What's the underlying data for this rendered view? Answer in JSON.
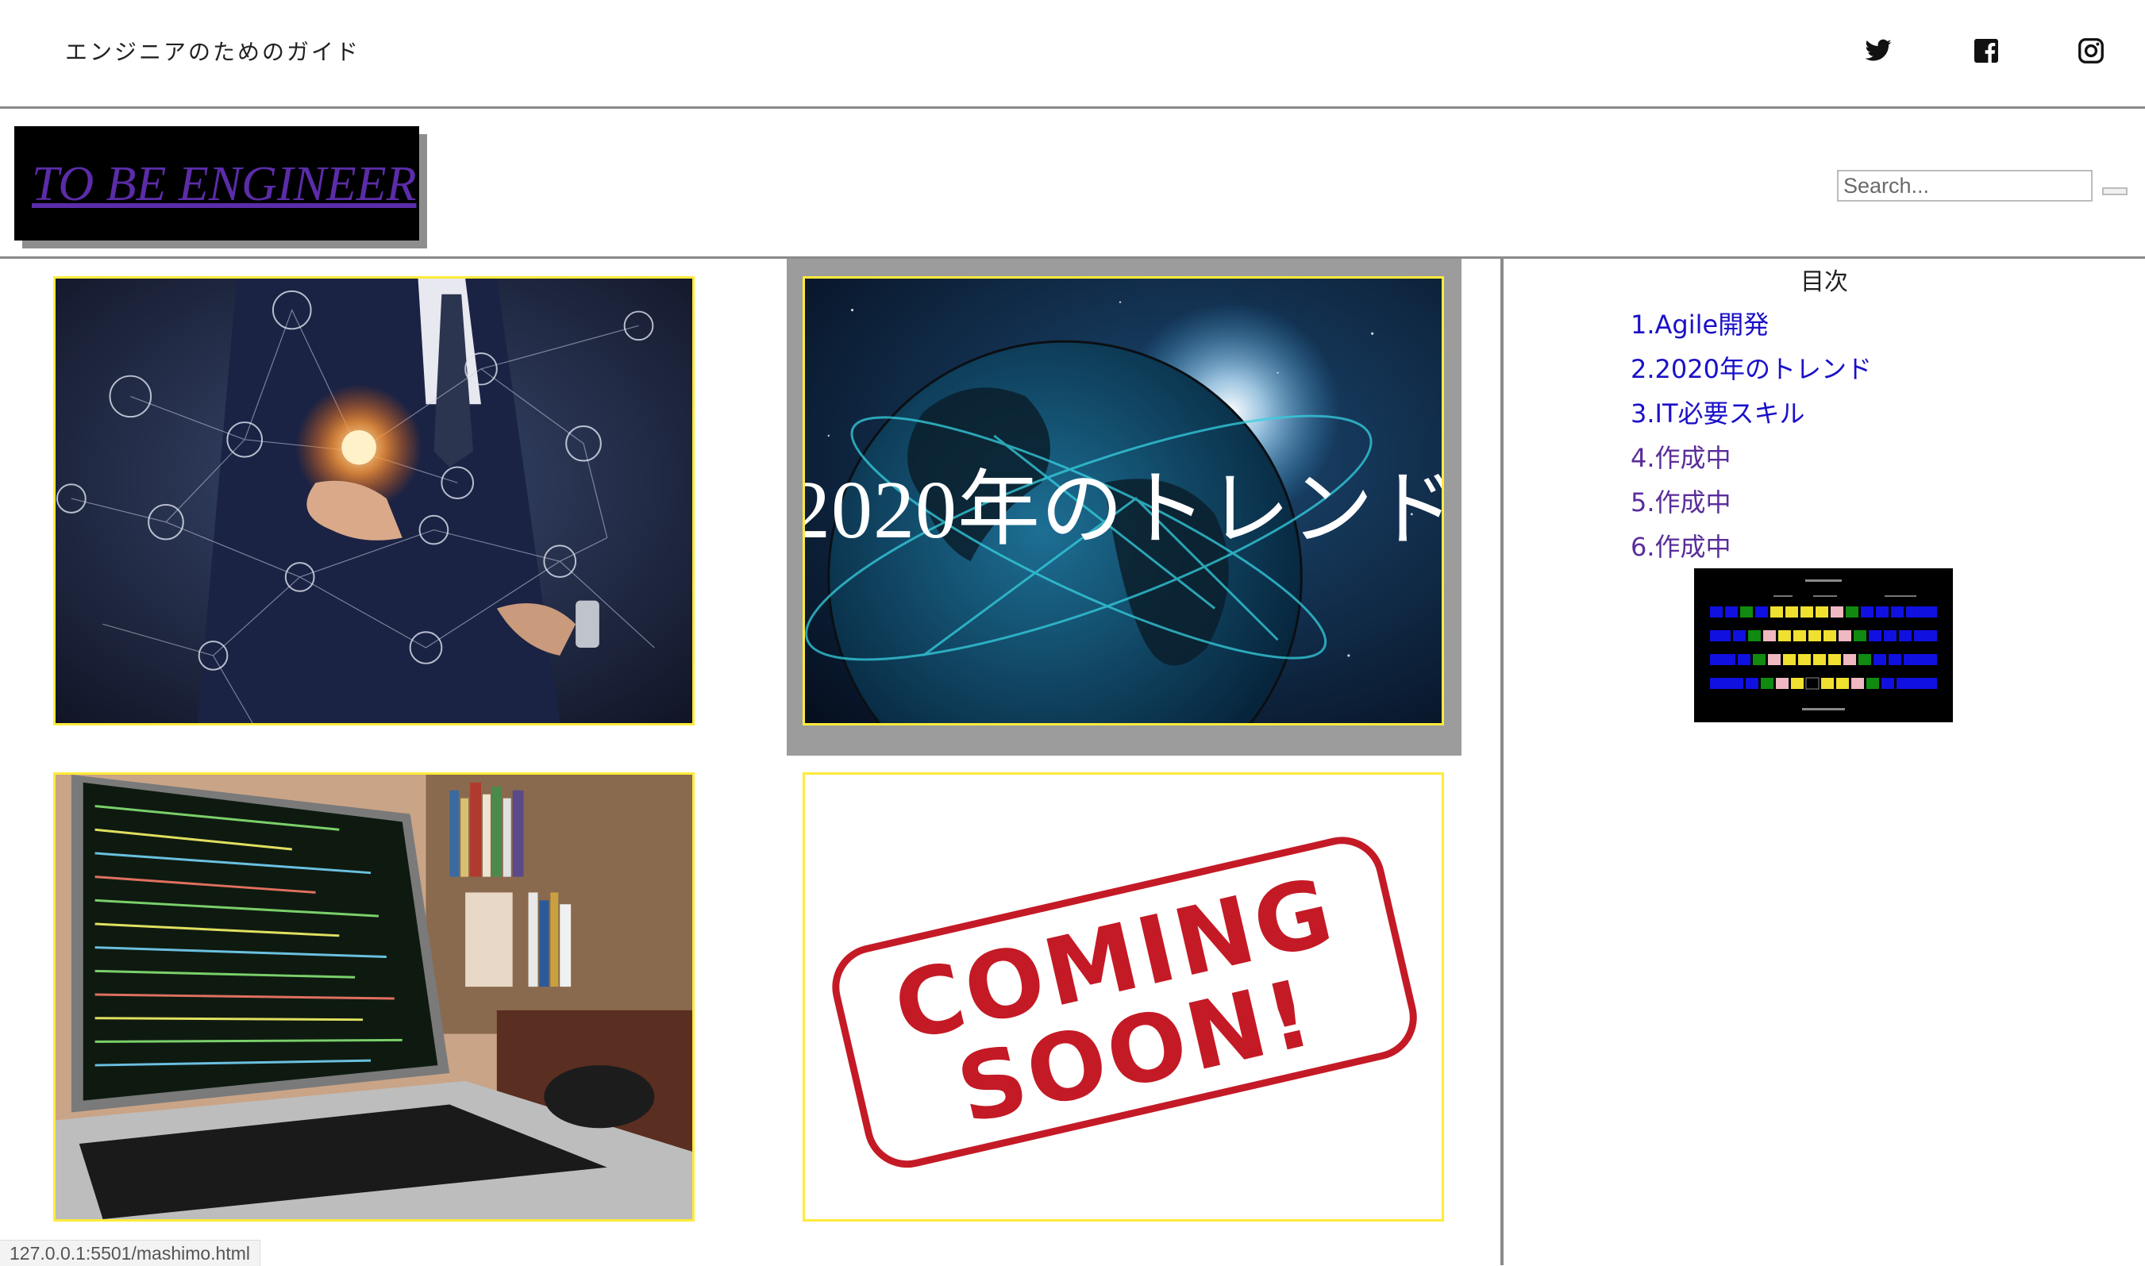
{
  "topbar": {
    "subtitle": "エンジニアのためのガイド",
    "social": [
      "twitter-icon",
      "facebook-icon",
      "instagram-icon"
    ]
  },
  "header": {
    "logo_text": "TO BE ENGINEER",
    "search_placeholder": "Search..."
  },
  "cards": [
    {
      "image": "businessman-network-photo"
    },
    {
      "image": "globe-night-photo",
      "title": "2020年のトレンド"
    },
    {
      "image": "laptop-code-photo"
    },
    {
      "image": "coming-soon-stamp",
      "stamp_line1": "COMING",
      "stamp_line2": "SOON!"
    }
  ],
  "sidebar": {
    "toc_title": "目次",
    "items": [
      {
        "label": "1.Agile開発",
        "state": "link"
      },
      {
        "label": "2.2020年のトレンド",
        "state": "link"
      },
      {
        "label": "3.IT必要スキル",
        "state": "link"
      },
      {
        "label": "4.作成中",
        "state": "visited"
      },
      {
        "label": "5.作成中",
        "state": "visited"
      },
      {
        "label": "6.作成中",
        "state": "visited"
      }
    ]
  },
  "statusbar": {
    "url": "127.0.0.1:5501/mashimo.html"
  },
  "colors": {
    "card_border": "#ffeb3b",
    "link": "#1a10c8",
    "link_visited": "#5a2d9a",
    "logo_text": "#5b2ca8",
    "divider": "#8a8a8a"
  }
}
